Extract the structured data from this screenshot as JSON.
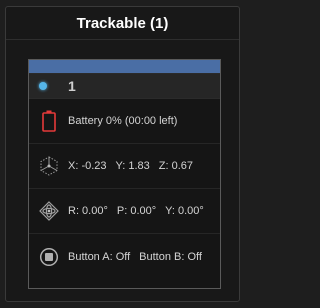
{
  "panel": {
    "title": "Trackable (1)"
  },
  "trackable": {
    "color": "#4a6ea5",
    "status_color": "#55b6ea",
    "id": "1",
    "battery": {
      "icon": "battery-empty-icon",
      "text": "Battery 0% (00:00 left)",
      "level_percent": 0,
      "color": "#e53a3a"
    },
    "position": {
      "icon": "position-axes-icon",
      "x": "X: -0.23",
      "y": "Y: 1.83",
      "z": "Z: 0.67"
    },
    "rotation": {
      "icon": "rotation-gizmo-icon",
      "r": "R: 0.00°",
      "p": "P: 0.00°",
      "yaw": "Y: 0.00°"
    },
    "buttons": {
      "icon": "button-icon",
      "a": "Button A: Off",
      "b": "Button B: Off"
    }
  }
}
